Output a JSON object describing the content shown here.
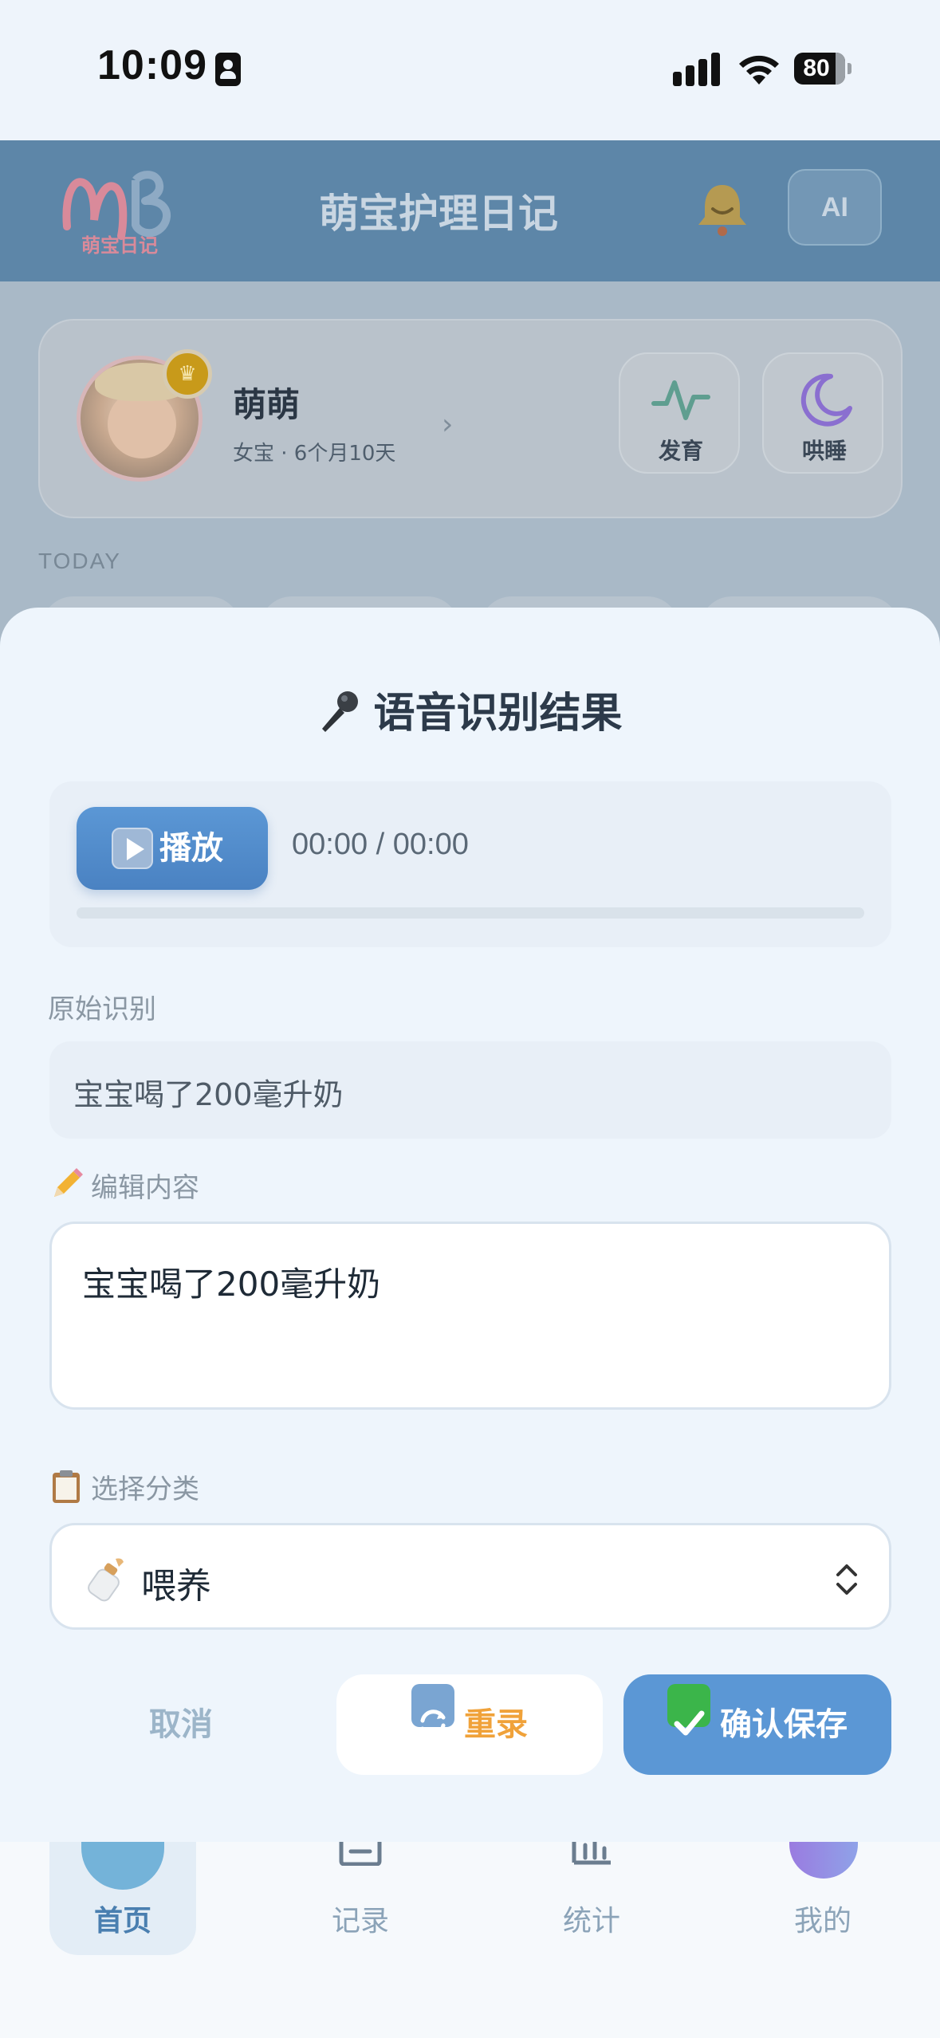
{
  "status_bar": {
    "time": "10:09",
    "battery": "80",
    "battery_level": 0.8
  },
  "header": {
    "logo_text": "萌宝日记",
    "title": "萌宝护理日记",
    "ai_label": "AI"
  },
  "profile": {
    "name": "萌萌",
    "info": "女宝 · 6个月10天",
    "quick_actions": [
      {
        "label": "发育",
        "icon": "activity-icon"
      },
      {
        "label": "哄睡",
        "icon": "moon-icon"
      }
    ]
  },
  "today_label": "TODAY",
  "sheet": {
    "title": "语音识别结果",
    "player": {
      "play_label": "播放",
      "time": "00:00 / 00:00",
      "progress": 0
    },
    "raw_label": "原始识别",
    "raw_text": "宝宝喝了200毫升奶",
    "edit_label": "编辑内容",
    "edit_text": "宝宝喝了200毫升奶",
    "category_label": "选择分类",
    "category_value": "喂养",
    "buttons": {
      "cancel": "取消",
      "redo": "重录",
      "save": "确认保存"
    }
  },
  "nav": [
    {
      "label": "首页",
      "active": true
    },
    {
      "label": "记录",
      "active": false
    },
    {
      "label": "统计",
      "active": false
    },
    {
      "label": "我的",
      "active": false
    }
  ],
  "colors": {
    "accent": "#5b97d5",
    "redo": "#f0a23a",
    "header": "#5d86a8"
  }
}
